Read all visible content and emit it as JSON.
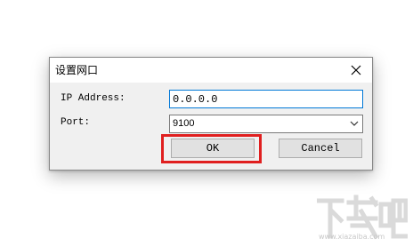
{
  "dialog": {
    "title": "设置网口",
    "ip_label": "IP Address:",
    "ip_value": "0.0.0.0",
    "port_label": "Port:",
    "port_selected": "9100",
    "ok_label": "OK",
    "cancel_label": "Cancel"
  },
  "watermark": {
    "text": "下载吧",
    "url": "www.xiazaiba.com"
  },
  "colors": {
    "highlight": "#e01f1f",
    "focus_border": "#0078d7"
  },
  "icons": {
    "close": "close-icon",
    "dropdown": "chevron-down-icon"
  }
}
